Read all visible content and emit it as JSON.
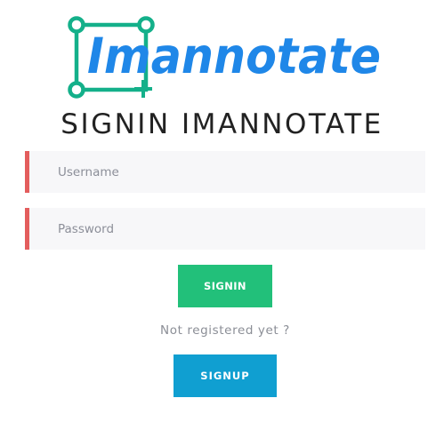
{
  "brand": {
    "name": "Imannotate"
  },
  "page": {
    "title": "SIGNIN IMANNOTATE"
  },
  "form": {
    "username_placeholder": "Username",
    "password_placeholder": "Password",
    "signin_label": "SIGNIN",
    "not_registered_text": "Not registered yet ?",
    "signup_label": "SIGNUP"
  },
  "colors": {
    "accent_green": "#22c07a",
    "accent_blue": "#109fd1",
    "field_marker": "#e35d5d",
    "logo_teal": "#14b08a",
    "logo_blue": "#1f87e8"
  }
}
